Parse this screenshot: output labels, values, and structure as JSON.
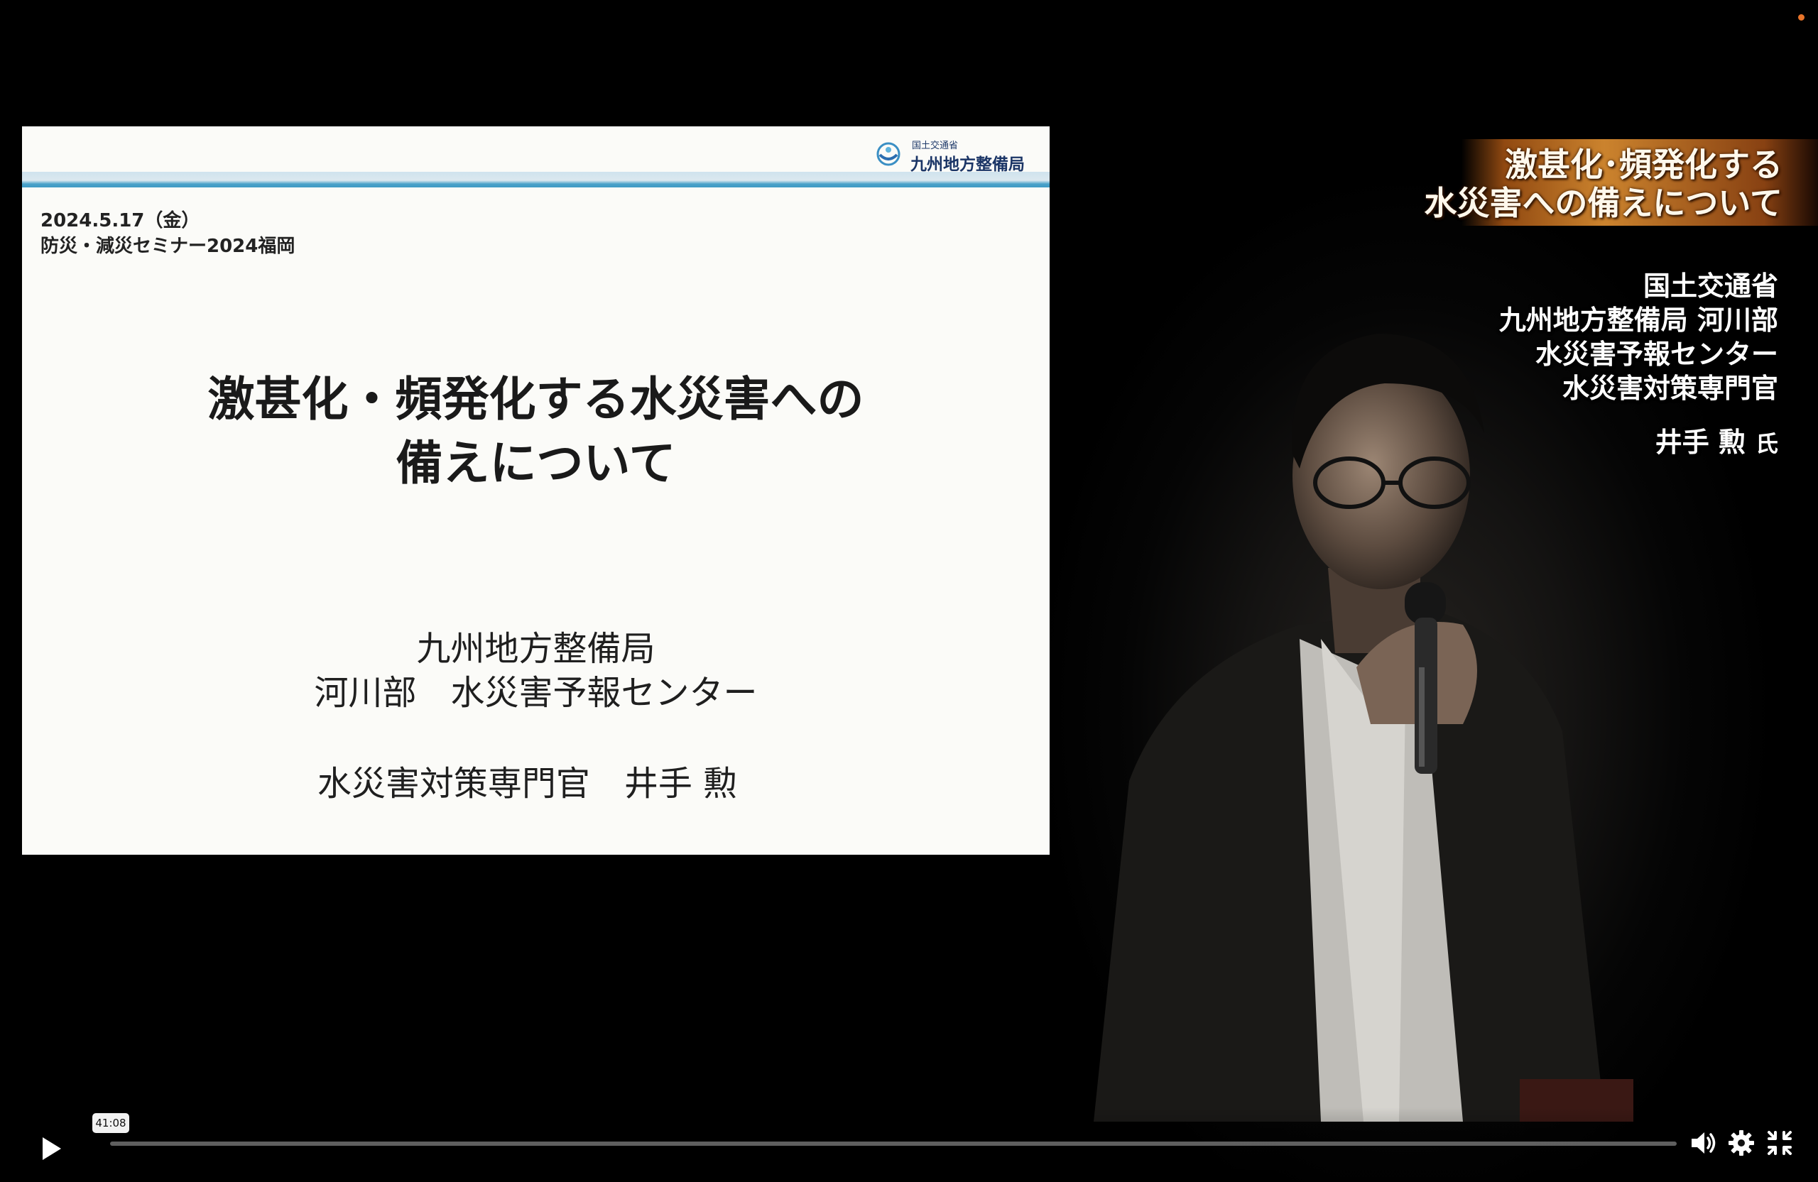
{
  "slide": {
    "logo_ministry": "国土交通省",
    "logo_bureau": "九州地方整備局",
    "date": "2024.5.17（金）",
    "event": "防災・減災セミナー2024福岡",
    "title_line1": "激甚化・頻発化する水災害への",
    "title_line2": "備えについて",
    "org_line1": "九州地方整備局",
    "org_line2": "河川部　水災害予報センター",
    "presenter_line": "水災害対策専門官　井手 勲"
  },
  "overlay": {
    "topic_line1": "激甚化･頻発化する",
    "topic_line2": "水災害への備えについて",
    "affiliation": [
      "国土交通省",
      "九州地方整備局 河川部",
      "水災害予報センター",
      "水災害対策専門官"
    ],
    "speaker_name": "井手 勲",
    "honorific": "氏"
  },
  "player": {
    "hover_time": "41:08",
    "progress_fraction": 0.0,
    "icons": [
      "play-icon",
      "volume-icon",
      "gear-icon",
      "exit-fullscreen-icon"
    ]
  },
  "colors": {
    "banner_orange": "#d68a30",
    "slide_band_blue": "#3e9ac4",
    "status_dot": "#e8742a"
  }
}
